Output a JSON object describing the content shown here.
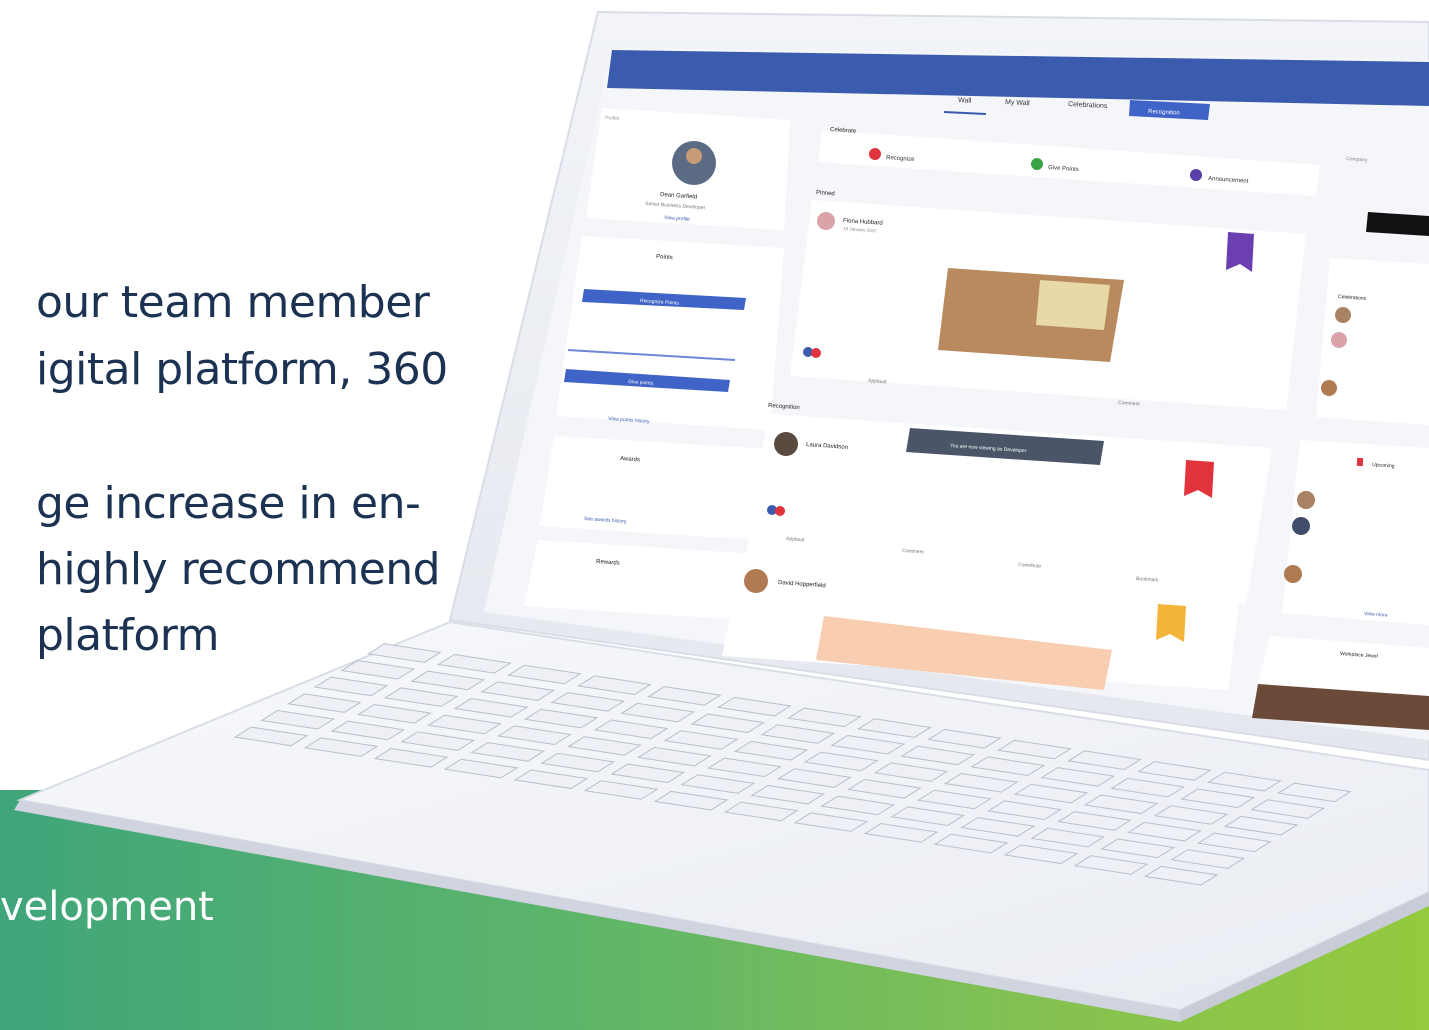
{
  "quote": {
    "lines": [
      "our team member",
      "igital platform, 360",
      "ge increase in en-",
      "highly recommend",
      "platform"
    ]
  },
  "attribution": {
    "role": "velopment"
  },
  "colors": {
    "navy_text": "#1b3252",
    "band_start": "#3fa57a",
    "band_end": "#95c93e",
    "app_header": "#3b5cae"
  },
  "screen": {
    "tabs": [
      "Wall",
      "My Wall",
      "Celebrations",
      "Recognition"
    ],
    "profile": {
      "caption": "Profile",
      "name": "Dean Garfield",
      "title": "Senior Business Developer",
      "link": "View profile"
    },
    "points": {
      "title": "Points",
      "button1": "Recognize Points",
      "button2": "Give points",
      "link": "View points history"
    },
    "awards": {
      "title": "Awards",
      "link": "See awards history"
    },
    "rewards": {
      "title": "Rewards"
    },
    "celebrate": {
      "title": "Celebrate",
      "actions": [
        "Recognize",
        "Give Points",
        "Announcement"
      ]
    },
    "pinned": {
      "title": "Pinned",
      "author": "Fiona Hubbard",
      "date": "18 January 2022",
      "actions": [
        "Applaud",
        "Comment"
      ]
    },
    "recognition": {
      "title": "Recognition",
      "author": "Laura Davidson",
      "toast": "You are now viewing as Developer",
      "actions": [
        "Applaud",
        "Comment",
        "Contribute",
        "Bookmark"
      ]
    },
    "third_post": {
      "author": "David Hopperfield"
    },
    "right": {
      "company": "Company",
      "celebrations": "Celebrations",
      "upcoming": "Upcoming",
      "view_more": "View more",
      "workplace": "Workplace Jewel"
    }
  }
}
